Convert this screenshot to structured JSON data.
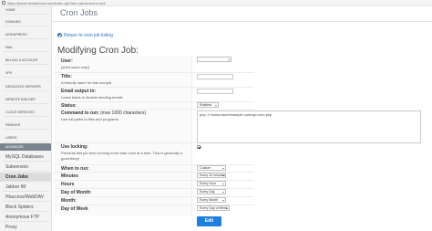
{
  "browser": {
    "url": "https://panel.dreamhost.com/index.cgi?tree=advanced.cron&"
  },
  "sidebar": {
    "items": [
      {
        "label": "HOME"
      },
      {
        "label": "DOMAINS"
      },
      {
        "label": "WORDPRESS"
      },
      {
        "label": "MAIL"
      },
      {
        "label": "BILLING & ACCOUNT"
      },
      {
        "label": "VPS"
      },
      {
        "label": "DEDICATED SERVERS"
      },
      {
        "label": "WEBSITE BUILDER"
      },
      {
        "label": "CLOUD SERVICES"
      },
      {
        "label": "REMIXER"
      },
      {
        "label": "USERS"
      }
    ],
    "section_label": "ADVANCED",
    "sub_items": [
      {
        "label": "MySQL Databases",
        "active": false
      },
      {
        "label": "Subversion",
        "active": false
      },
      {
        "label": "Cron Jobs",
        "active": true
      },
      {
        "label": "Jabber IM",
        "active": false
      },
      {
        "label": "Htaccess/WebDAV",
        "active": false
      },
      {
        "label": "Block Spiders",
        "active": false
      },
      {
        "label": "Anonymous FTP",
        "active": false
      },
      {
        "label": "Proxy",
        "active": false
      }
    ]
  },
  "header": {
    "breadcrumb": "Cron Jobs"
  },
  "main": {
    "back_link": "Return to cron job listing",
    "title": "Modifying Cron Job:",
    "fields": {
      "user": {
        "label": "User:",
        "hint": "(shell users only!)",
        "value": ""
      },
      "title": {
        "label": "Title:",
        "hint": "A friendly name for this cronjob",
        "value": ""
      },
      "email": {
        "label": "Email output to:",
        "hint": "Leave blank to disable sending emails",
        "value": ""
      },
      "status": {
        "label": "Status:",
        "value": "Enabled"
      },
      "command": {
        "label": "Command to run:",
        "label_suffix": " (max 1000 characters)",
        "hint": "Use full paths to files and programs",
        "value": "php -f /home/user/example.com/wp-cron.php"
      },
      "locking": {
        "label": "Use locking:",
        "hint_lines": [
          "Prevents this job from running more than once at a time. This is generally a",
          "good thing!"
        ],
        "checked": true
      },
      "when": {
        "label": "When to run:",
        "value": "Custom"
      },
      "minutes": {
        "label": "Minutes",
        "value": "Every 10 minutes"
      },
      "hours": {
        "label": "Hours",
        "value": "Every Hour"
      },
      "day_of_month": {
        "label": "Day of Month:",
        "value": "Every Day"
      },
      "month": {
        "label": "Month:",
        "value": "Every Month"
      },
      "day_of_week": {
        "label": "Day of Week",
        "value": "Every Day of Week"
      }
    },
    "submit_label": "Edit"
  },
  "colors": {
    "accent": "#1d7fe0",
    "link": "#2f6db5",
    "sidebar_bg": "#f3f3f3",
    "section_bg": "#7b8590"
  }
}
